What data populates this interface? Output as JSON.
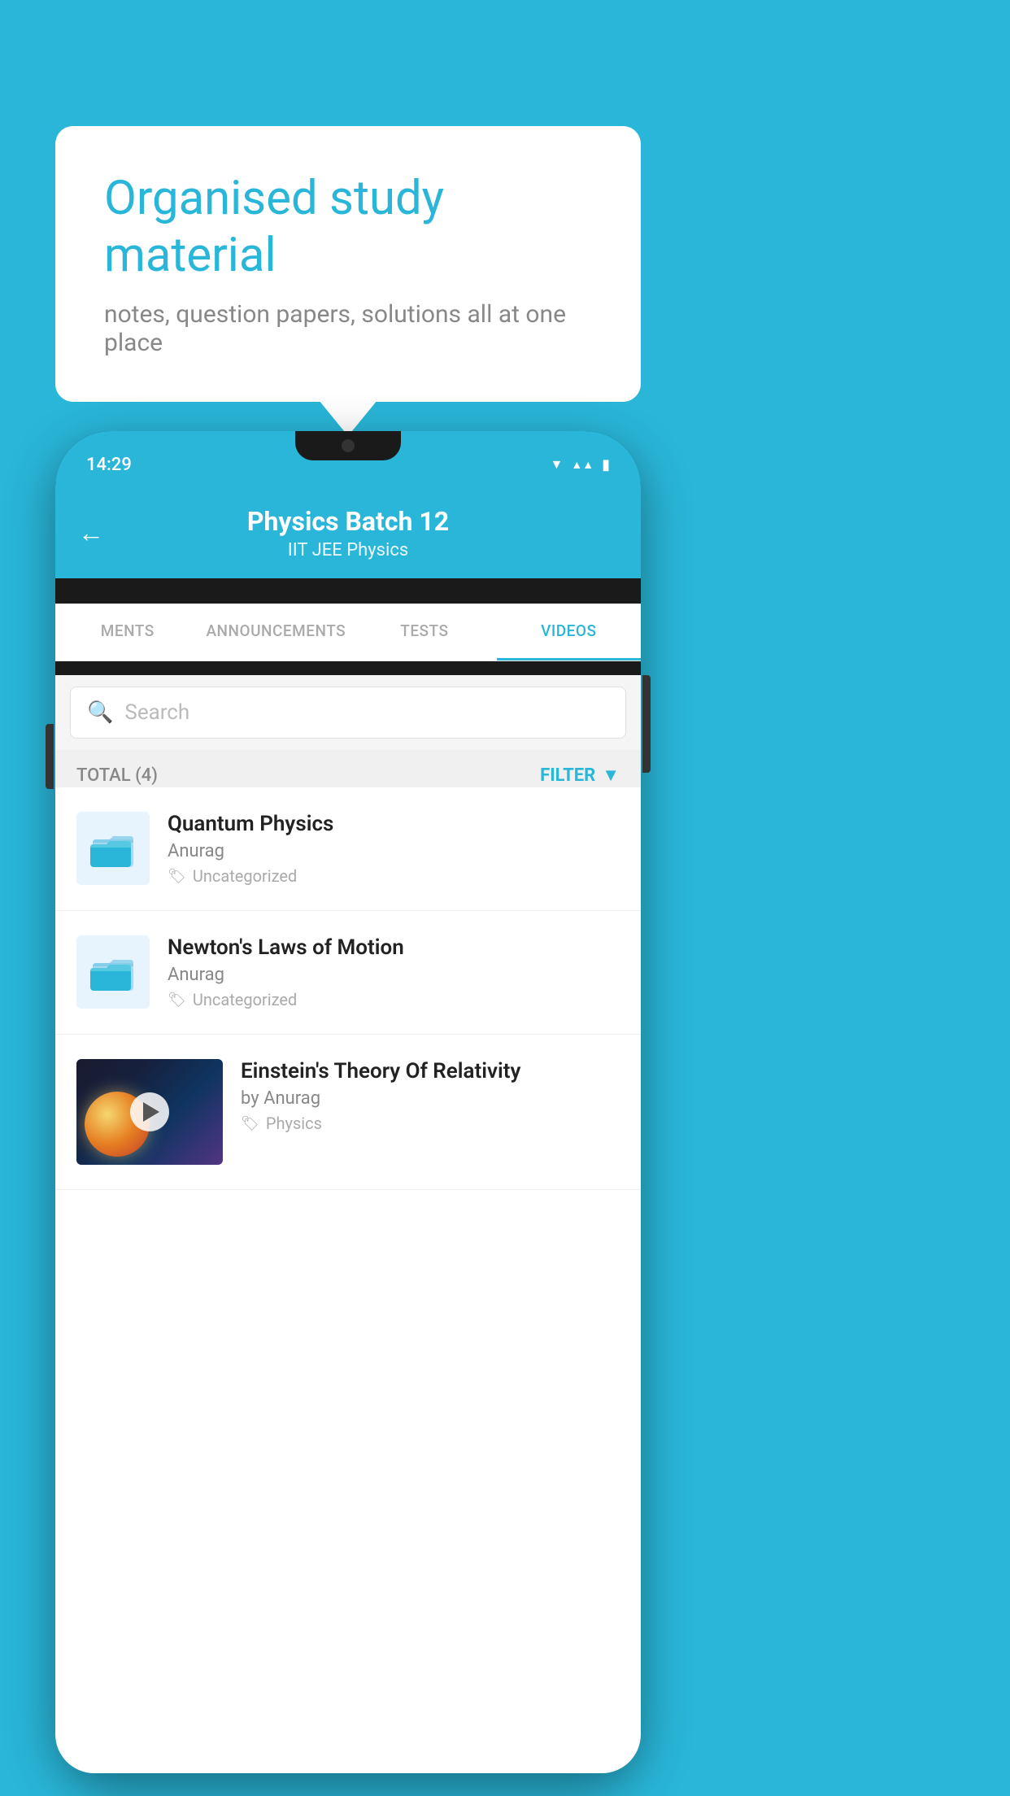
{
  "background_color": "#29B6D8",
  "speech_bubble": {
    "title": "Organised study material",
    "subtitle": "notes, question papers, solutions all at one place"
  },
  "phone": {
    "status_bar": {
      "time": "14:29",
      "icons": [
        "wifi",
        "signal",
        "battery"
      ]
    },
    "app_header": {
      "back_icon": "←",
      "title": "Physics Batch 12",
      "subtitle": "IIT JEE   Physics"
    },
    "tabs": [
      {
        "label": "MENTS",
        "active": false
      },
      {
        "label": "ANNOUNCEMENTS",
        "active": false
      },
      {
        "label": "TESTS",
        "active": false
      },
      {
        "label": "VIDEOS",
        "active": true
      }
    ],
    "search": {
      "placeholder": "Search"
    },
    "filter_bar": {
      "total_label": "TOTAL (4)",
      "filter_label": "FILTER",
      "filter_icon": "▼"
    },
    "videos": [
      {
        "title": "Quantum Physics",
        "author": "Anurag",
        "tag": "Uncategorized",
        "type": "folder"
      },
      {
        "title": "Newton's Laws of Motion",
        "author": "Anurag",
        "tag": "Uncategorized",
        "type": "folder"
      },
      {
        "title": "Einstein's Theory Of Relativity",
        "author": "by Anurag",
        "tag": "Physics",
        "type": "video"
      }
    ]
  }
}
